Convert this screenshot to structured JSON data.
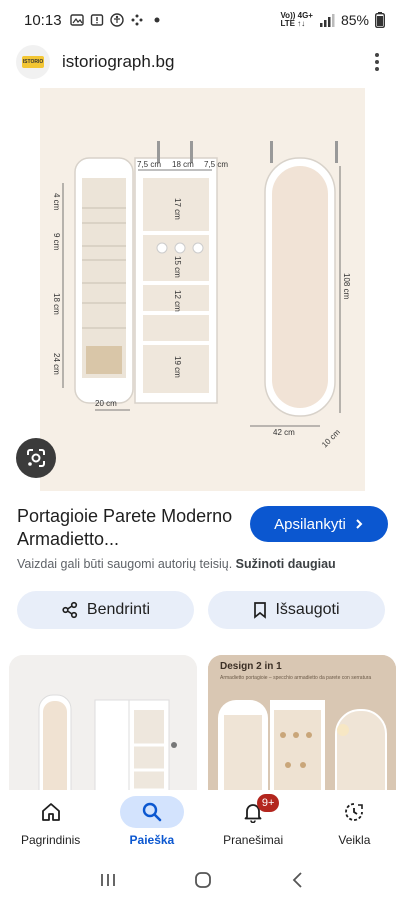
{
  "status_bar": {
    "time": "10:13",
    "net_top": "Vo)) 4G+",
    "net_bottom": "LTE ↑↓",
    "battery": "85%"
  },
  "site": {
    "logo_text": "ISTORIO",
    "name": "istoriograph.bg"
  },
  "product_image": {
    "dimension_labels": [
      "7,5 cm",
      "18 cm",
      "7,5 cm",
      "4 cm",
      "9 cm",
      "18 cm",
      "24 cm",
      "17 cm",
      "15 cm",
      "12 cm",
      "19 cm",
      "20 cm",
      "108 cm",
      "42 cm",
      "10 cm"
    ]
  },
  "result": {
    "title": "Portagioie Parete Moderno Armadietto...",
    "visit_label": "Apsilankyti",
    "copyright_text": "Vaizdai gali būti saugomi autorių teisių.",
    "learn_more": "Sužinoti daugiau"
  },
  "actions": {
    "share_label": "Bendrinti",
    "save_label": "Išsaugoti"
  },
  "related": {
    "thumb2_heading": "Design 2 in 1",
    "thumb2_sub": "Armadietto portagioie – specchio armadietto da parete con serratura"
  },
  "bottom_nav": {
    "items": [
      {
        "label": "Pagrindinis",
        "icon": "home-icon"
      },
      {
        "label": "Paieška",
        "icon": "search-icon"
      },
      {
        "label": "Pranešimai",
        "icon": "bell-icon",
        "badge": "9+"
      },
      {
        "label": "Veikla",
        "icon": "activity-icon"
      }
    ]
  },
  "colors": {
    "accent": "#0b57d0",
    "chip_bg": "#e8eef9",
    "badge": "#b3261e"
  }
}
